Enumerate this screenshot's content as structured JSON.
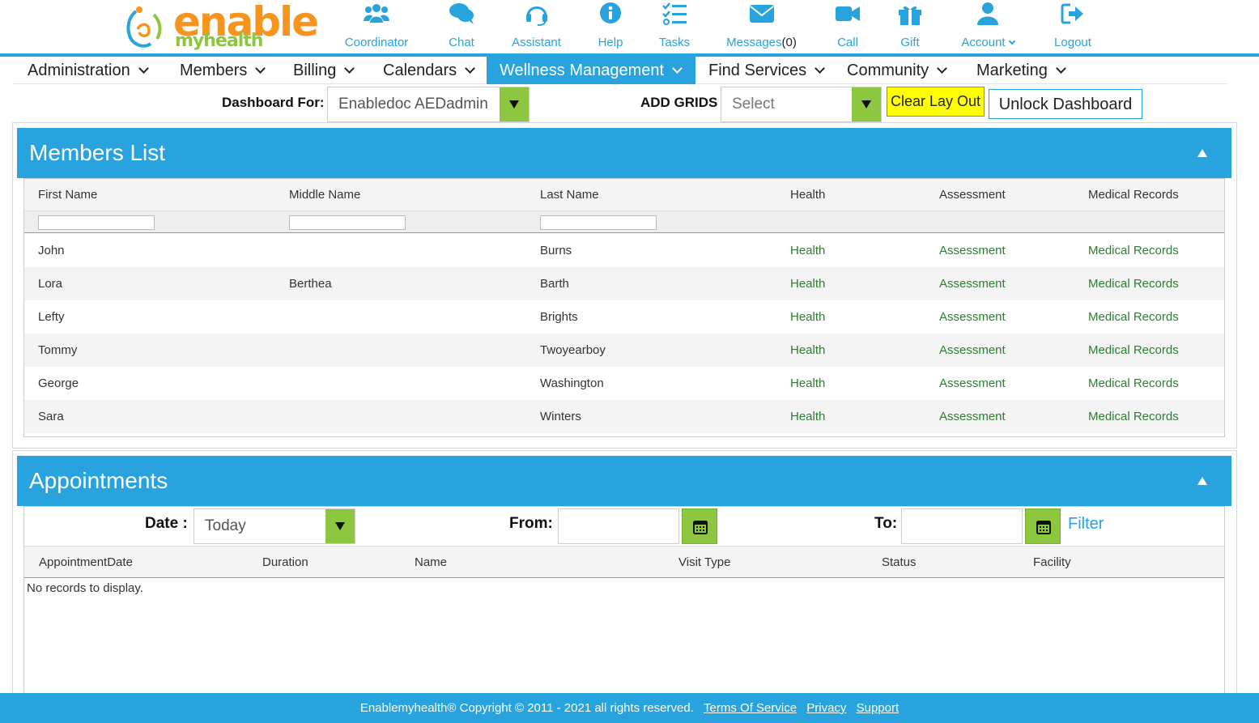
{
  "brand": {
    "name": "enable",
    "sub": "myhealth"
  },
  "topnav": [
    {
      "label": "Coordinator",
      "icon": "users-icon"
    },
    {
      "label": "Chat",
      "icon": "chat-icon"
    },
    {
      "label": "Assistant",
      "icon": "headset-icon"
    },
    {
      "label": "Help",
      "icon": "info-icon"
    },
    {
      "label": "Tasks",
      "icon": "tasks-icon"
    },
    {
      "label": "Messages",
      "count": "(0)",
      "icon": "envelope-icon"
    },
    {
      "label": "Call",
      "icon": "video-icon"
    },
    {
      "label": "Gift",
      "icon": "gift-icon"
    },
    {
      "label": "Account",
      "icon": "user-icon"
    },
    {
      "label": "Logout",
      "icon": "logout-icon"
    }
  ],
  "menu": [
    "Administration",
    "Members",
    "Billing",
    "Calendars",
    "Wellness Management",
    "Find Services",
    "Community",
    "Marketing"
  ],
  "active_menu": "Wellness Management",
  "dashboard": {
    "for_label": "Dashboard For:",
    "for_value": "Enabledoc AEDadmin",
    "add_grids_label": "ADD GRIDS",
    "add_grids_value": "Select",
    "clear_layout": "Clear Lay Out",
    "unlock": "Unlock Dashboard"
  },
  "members": {
    "title": "Members List",
    "columns": [
      "First Name",
      "Middle Name",
      "Last Name",
      "Health",
      "Assessment",
      "Medical Records"
    ],
    "rows": [
      {
        "first": "John",
        "middle": "",
        "last": "Burns",
        "health": "Health",
        "assessment": "Assessment",
        "records": "Medical Records"
      },
      {
        "first": "Lora",
        "middle": "Berthea",
        "last": "Barth",
        "health": "Health",
        "assessment": "Assessment",
        "records": "Medical Records"
      },
      {
        "first": "Lefty",
        "middle": "",
        "last": "Brights",
        "health": "Health",
        "assessment": "Assessment",
        "records": "Medical Records"
      },
      {
        "first": "Tommy",
        "middle": "",
        "last": "Twoyearboy",
        "health": "Health",
        "assessment": "Assessment",
        "records": "Medical Records"
      },
      {
        "first": "George",
        "middle": "",
        "last": "Washington",
        "health": "Health",
        "assessment": "Assessment",
        "records": "Medical Records"
      },
      {
        "first": "Sara",
        "middle": "",
        "last": "Winters",
        "health": "Health",
        "assessment": "Assessment",
        "records": "Medical Records"
      }
    ]
  },
  "appointments": {
    "title": "Appointments",
    "date_label": "Date :",
    "date_value": "Today",
    "from_label": "From:",
    "to_label": "To:",
    "filter": "Filter",
    "columns": [
      "AppointmentDate",
      "Duration",
      "Name",
      "Visit Type",
      "Status",
      "Facility"
    ],
    "empty": "No records to display."
  },
  "footer": {
    "copyright": "Enablemyhealth® Copyright © 2011 - 2021 all rights reserved.",
    "terms": "Terms Of Service",
    "privacy": "Privacy",
    "support": "Support"
  },
  "colors": {
    "brand_blue": "#29a3dd",
    "accent_green": "#8dc63f",
    "logo_orange": "#f7941d",
    "link_green": "#2e7d32",
    "highlight_yellow": "#ffff00"
  }
}
